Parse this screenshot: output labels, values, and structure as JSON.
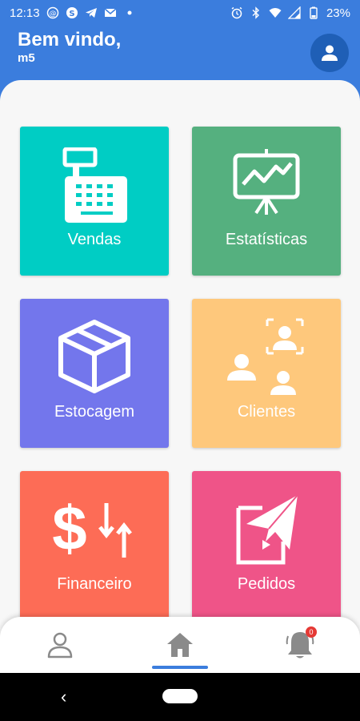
{
  "status_bar": {
    "time": "12:13",
    "battery": "23%",
    "left_icons": [
      "at-sign-icon",
      "skype-icon",
      "telegram-icon",
      "gmail-icon",
      "dot-icon"
    ],
    "right_icons": [
      "alarm-icon",
      "bluetooth-icon",
      "wifi-icon",
      "signal-icon",
      "battery-icon"
    ]
  },
  "header": {
    "greeting": "Bem vindo,",
    "username": "m5",
    "avatar_icon": "person-icon"
  },
  "tiles": [
    {
      "id": "vendas",
      "label": "Vendas",
      "color": "#00cdc4",
      "icon": "cash-register-icon"
    },
    {
      "id": "estatisticas",
      "label": "Estatísticas",
      "color": "#55b07f",
      "icon": "presentation-chart-icon"
    },
    {
      "id": "estocagem",
      "label": "Estocagem",
      "color": "#7376ec",
      "icon": "box-icon"
    },
    {
      "id": "clientes",
      "label": "Clientes",
      "color": "#fec87c",
      "icon": "customers-icon"
    },
    {
      "id": "financeiro",
      "label": "Financeiro",
      "color": "#fd6c56",
      "icon": "dollar-transfer-icon"
    },
    {
      "id": "pedidos",
      "label": "Pedidos",
      "color": "#ef5488",
      "icon": "send-order-icon"
    }
  ],
  "bottom_nav": {
    "items": [
      {
        "id": "profile",
        "icon": "person-outline-icon"
      },
      {
        "id": "home",
        "icon": "home-icon",
        "active": true
      },
      {
        "id": "notifications",
        "icon": "bell-icon",
        "badge": "0"
      }
    ]
  }
}
